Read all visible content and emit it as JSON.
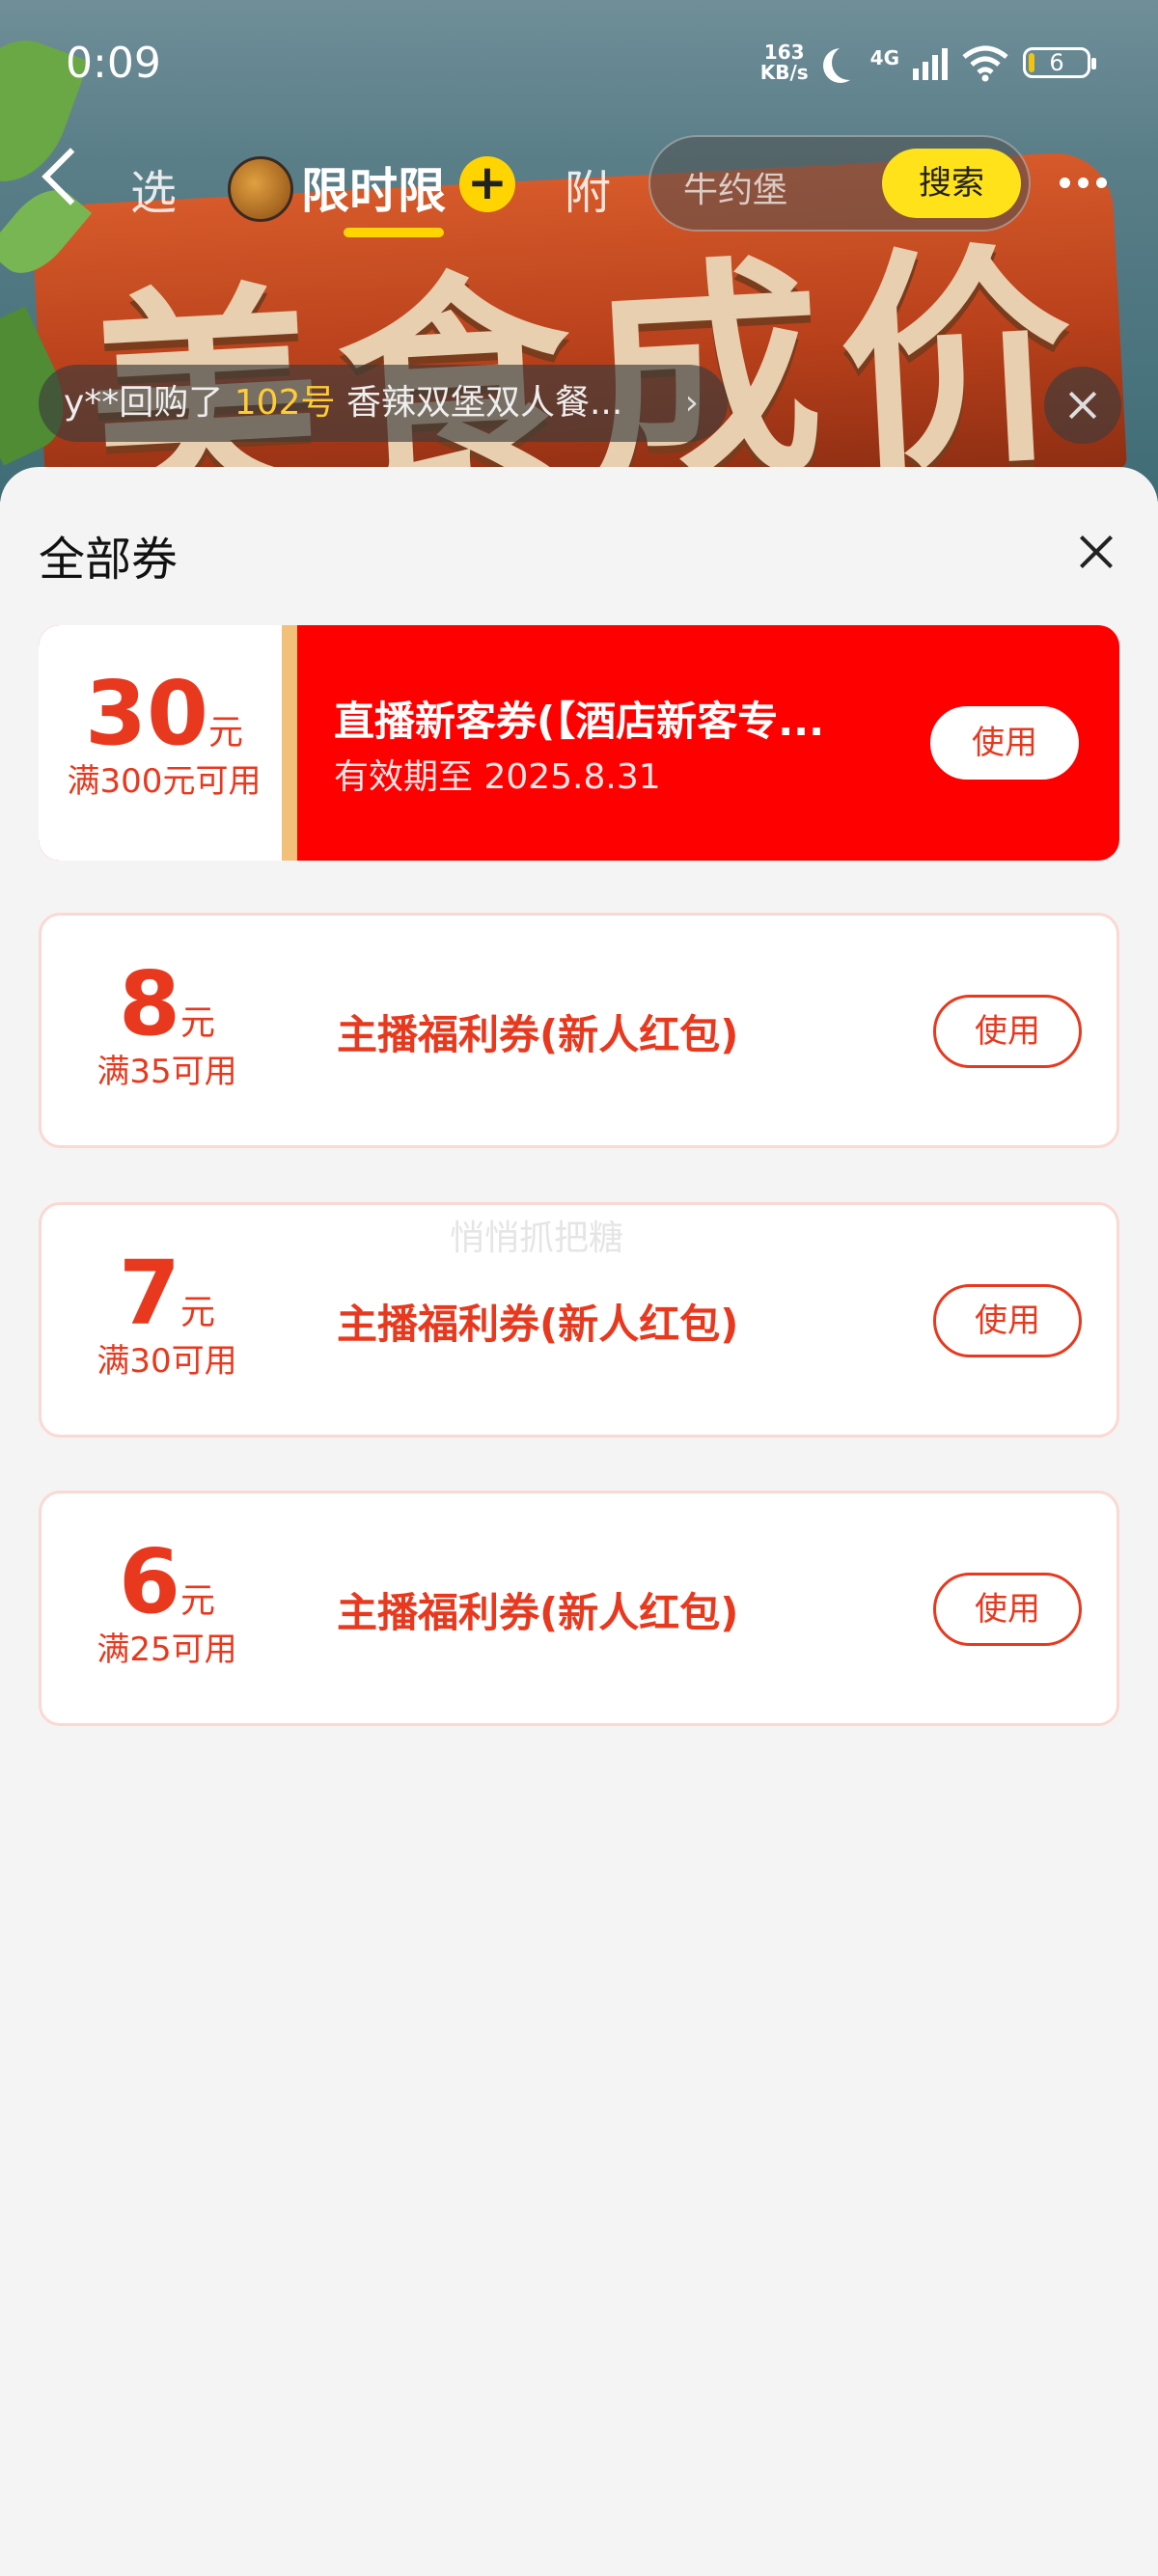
{
  "status_bar": {
    "time": "0:09",
    "speed_value": "163",
    "speed_unit": "KB/s",
    "network": "4G",
    "battery": "6"
  },
  "header": {
    "nav_tab_left": "选",
    "room_title": "限时限",
    "nav_tab_right": "附",
    "search_placeholder": "牛约堡",
    "search_button": "搜索",
    "poster_text": "美食成价"
  },
  "ticker": {
    "user": "y**回购了",
    "number": "102号",
    "item": "香辣双堡双人餐...",
    "arrow": "›"
  },
  "sheet": {
    "title": "全部券",
    "coupons": [
      {
        "amount": "30",
        "unit": "元",
        "condition": "满300元可用",
        "title": "直播新客券(【酒店新客专...",
        "validity": "有效期至 2025.8.31",
        "action": "使用"
      },
      {
        "amount": "8",
        "unit": "元",
        "condition": "满35可用",
        "title": "主播福利券(新人红包)",
        "action": "使用"
      },
      {
        "amount": "7",
        "unit": "元",
        "condition": "满30可用",
        "title": "主播福利券(新人红包)",
        "action": "使用"
      },
      {
        "amount": "6",
        "unit": "元",
        "condition": "满25可用",
        "title": "主播福利券(新人红包)",
        "action": "使用"
      }
    ],
    "watermark": "悄悄抓把糖"
  }
}
